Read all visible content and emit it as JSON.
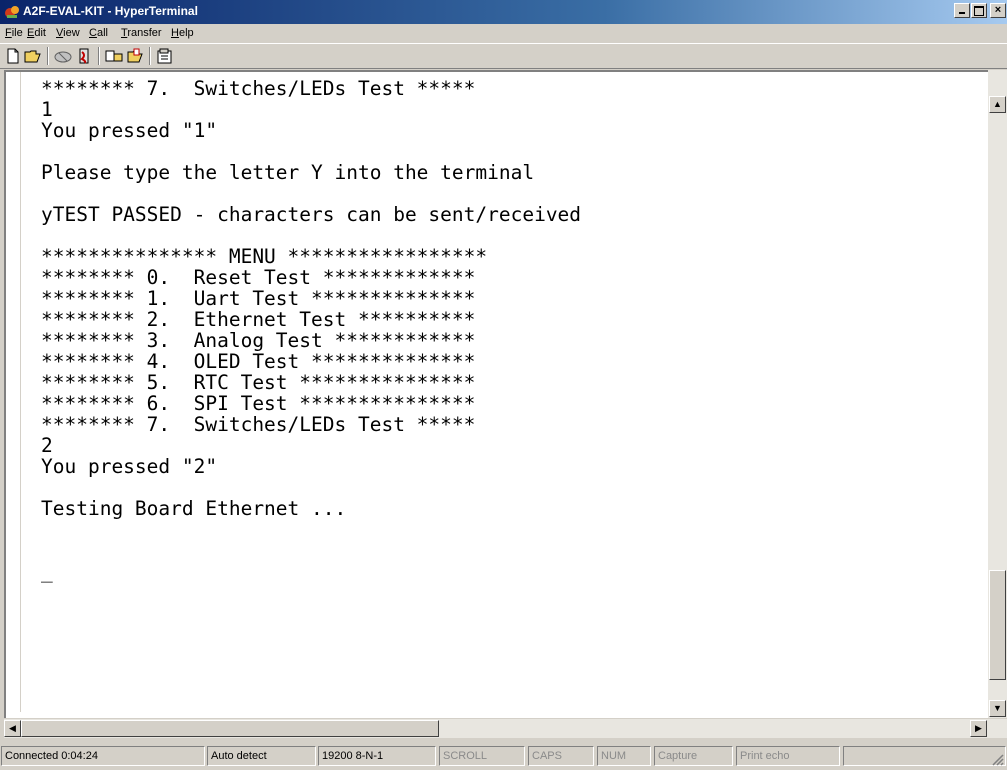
{
  "window": {
    "title": "A2F-EVAL-KIT - HyperTerminal"
  },
  "menu": [
    {
      "hotkey": "F",
      "rest": "ile"
    },
    {
      "hotkey": "E",
      "rest": "dit"
    },
    {
      "hotkey": "V",
      "rest": "iew"
    },
    {
      "hotkey": "C",
      "rest": "all"
    },
    {
      "hotkey": "T",
      "rest": "ransfer"
    },
    {
      "hotkey": "H",
      "rest": "elp"
    }
  ],
  "toolbar": {
    "buttons": [
      "new-connection-icon",
      "open-icon",
      "connect-icon",
      "disconnect-icon",
      "send-icon",
      "receive-icon",
      "properties-icon"
    ]
  },
  "terminal": {
    "lines": [
      "******** 7.  Switches/LEDs Test *****",
      "1",
      "You pressed \"1\"",
      "",
      "Please type the letter Y into the terminal",
      "",
      "yTEST PASSED - characters can be sent/received",
      "",
      "*************** MENU *****************",
      "******** 0.  Reset Test *************",
      "******** 1.  Uart Test **************",
      "******** 2.  Ethernet Test **********",
      "******** 3.  Analog Test ************",
      "******** 4.  OLED Test **************",
      "******** 5.  RTC Test ***************",
      "******** 6.  SPI Test ***************",
      "******** 7.  Switches/LEDs Test *****",
      "2",
      "You pressed \"2\"",
      "",
      "Testing Board Ethernet ...",
      "",
      "",
      "_"
    ]
  },
  "status": {
    "connected": "Connected 0:04:24",
    "detect": "Auto detect",
    "settings": "19200 8-N-1",
    "scroll": "SCROLL",
    "caps": "CAPS",
    "num": "NUM",
    "capture": "Capture",
    "print_echo": "Print echo"
  }
}
